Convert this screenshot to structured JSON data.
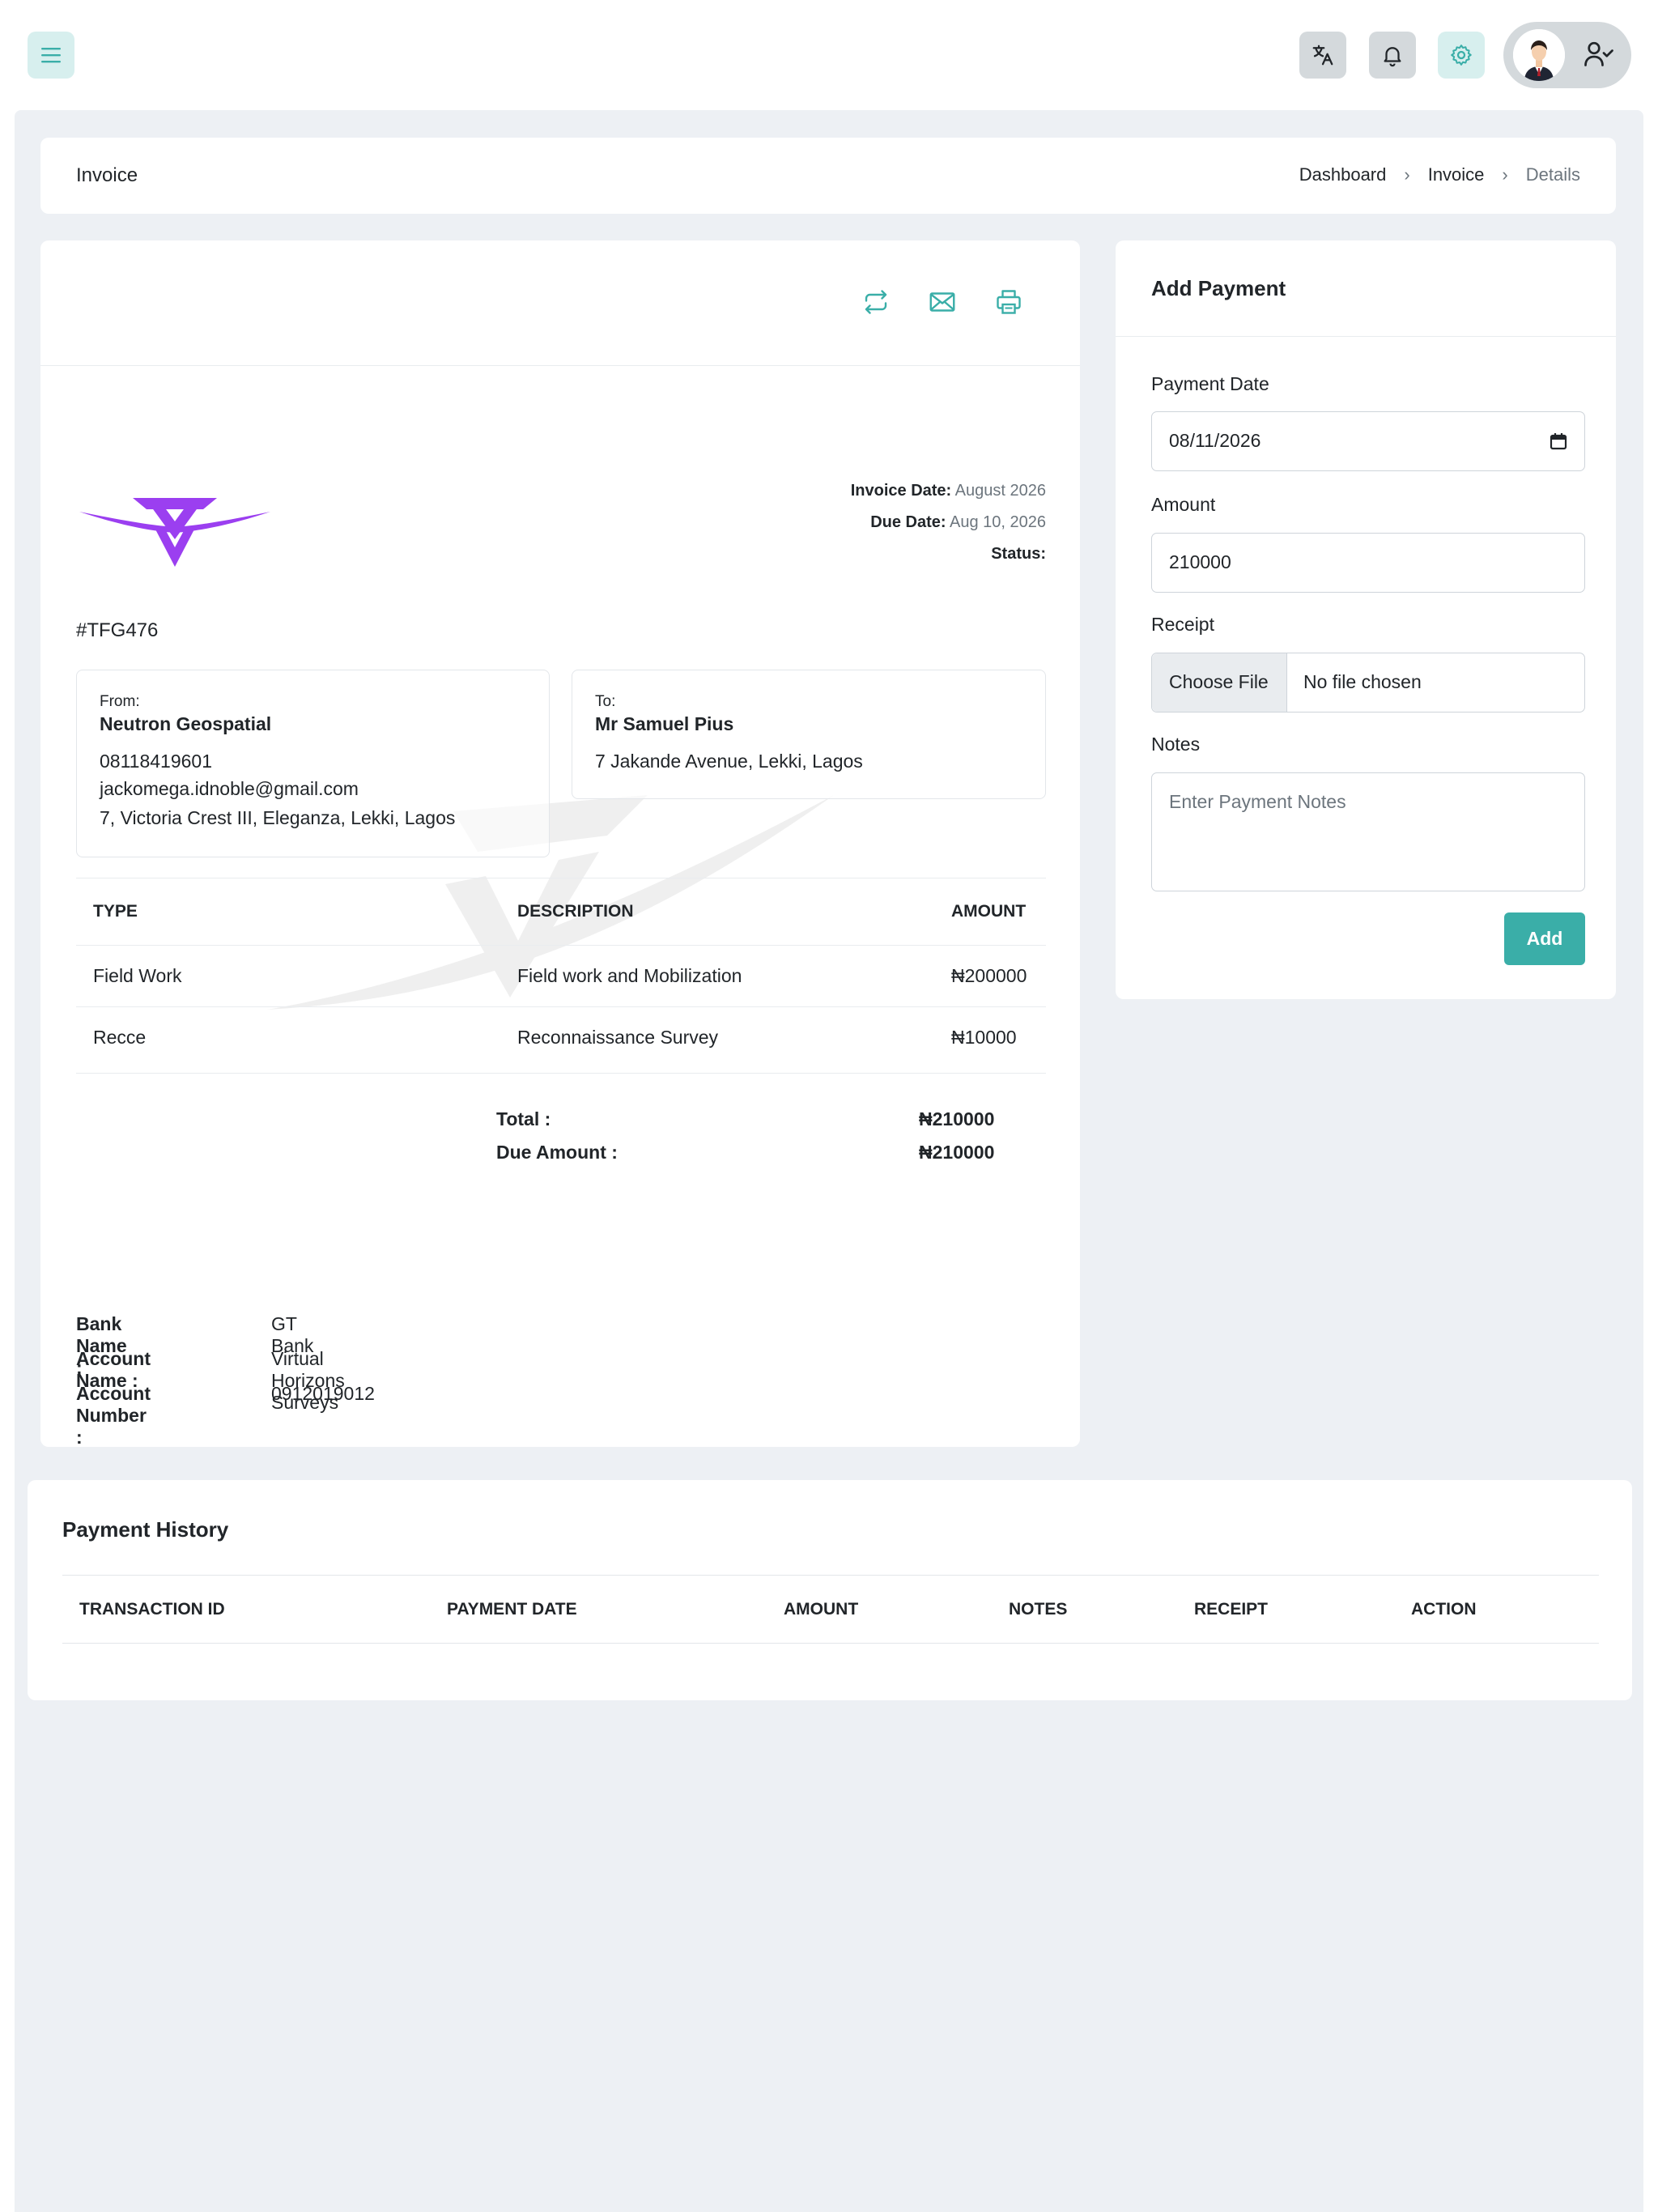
{
  "topbar": {
    "menu_icon": "menu-icon",
    "icons": [
      "translate-icon",
      "bell-icon",
      "gear-icon",
      "user-check-icon"
    ],
    "accent_color": "#3aaea8"
  },
  "page": {
    "title": "Invoice",
    "breadcrumb": [
      "Dashboard",
      "Invoice",
      "Details"
    ]
  },
  "invoice": {
    "toolbar_icons": [
      "repeat-icon",
      "mail-icon",
      "print-icon"
    ],
    "brand_color": "#9b3ff0",
    "invoice_date_label": "Invoice Date:",
    "invoice_date": "August 2026",
    "due_date_label": "Due Date:",
    "due_date": "Aug 10, 2026",
    "status_label": "Status:",
    "number": "#TFG476",
    "from": {
      "label": "From:",
      "name": "Neutron Geospatial",
      "phone": "08118419601",
      "email": "jackomega.idnoble@gmail.com",
      "address": "7, Victoria Crest III, Eleganza, Lekki, Lagos"
    },
    "to": {
      "label": "To:",
      "name": "Mr Samuel Pius",
      "address": "7 Jakande Avenue, Lekki, Lagos"
    },
    "table": {
      "headers": [
        "TYPE",
        "DESCRIPTION",
        "AMOUNT"
      ],
      "rows": [
        [
          "Field Work",
          "Field work and Mobilization",
          "₦200000"
        ],
        [
          "Recce",
          "Reconnaissance Survey",
          "₦10000"
        ]
      ]
    },
    "total_label": "Total :",
    "total_value": "₦210000",
    "due_label": "Due Amount :",
    "due_value": "₦210000",
    "bank": {
      "name_label": "Bank Name :",
      "name": "GT Bank",
      "account_name_label": "Account Name :",
      "account_name": "Virtual Horizons Surveys",
      "account_number_label": "Account Number :",
      "account_number": "0912019012"
    }
  },
  "payment": {
    "title": "Add Payment",
    "date_label": "Payment Date",
    "date_value": "08/11/2026",
    "amount_label": "Amount",
    "amount_value": "210000",
    "receipt_label": "Receipt",
    "choose_file": "Choose File",
    "no_file": "No file chosen",
    "notes_label": "Notes",
    "notes_placeholder": "Enter Payment Notes",
    "add_button": "Add"
  },
  "history": {
    "title": "Payment History",
    "headers": [
      "TRANSACTION ID",
      "PAYMENT DATE",
      "AMOUNT",
      "NOTES",
      "RECEIPT",
      "ACTION"
    ]
  }
}
